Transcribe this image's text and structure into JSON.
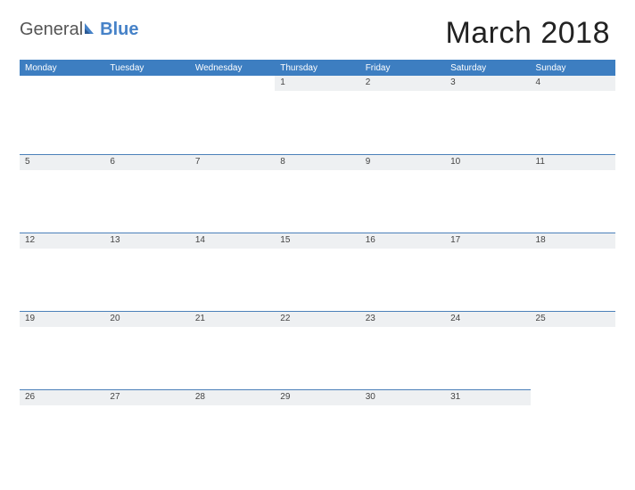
{
  "brand": {
    "part1": "General",
    "part2": "Blue"
  },
  "title": "March 2018",
  "weekdays": [
    "Monday",
    "Tuesday",
    "Wednesday",
    "Thursday",
    "Friday",
    "Saturday",
    "Sunday"
  ],
  "weeks": [
    [
      "",
      "",
      "",
      "1",
      "2",
      "3",
      "4"
    ],
    [
      "5",
      "6",
      "7",
      "8",
      "9",
      "10",
      "11"
    ],
    [
      "12",
      "13",
      "14",
      "15",
      "16",
      "17",
      "18"
    ],
    [
      "19",
      "20",
      "21",
      "22",
      "23",
      "24",
      "25"
    ],
    [
      "26",
      "27",
      "28",
      "29",
      "30",
      "31",
      ""
    ]
  ]
}
